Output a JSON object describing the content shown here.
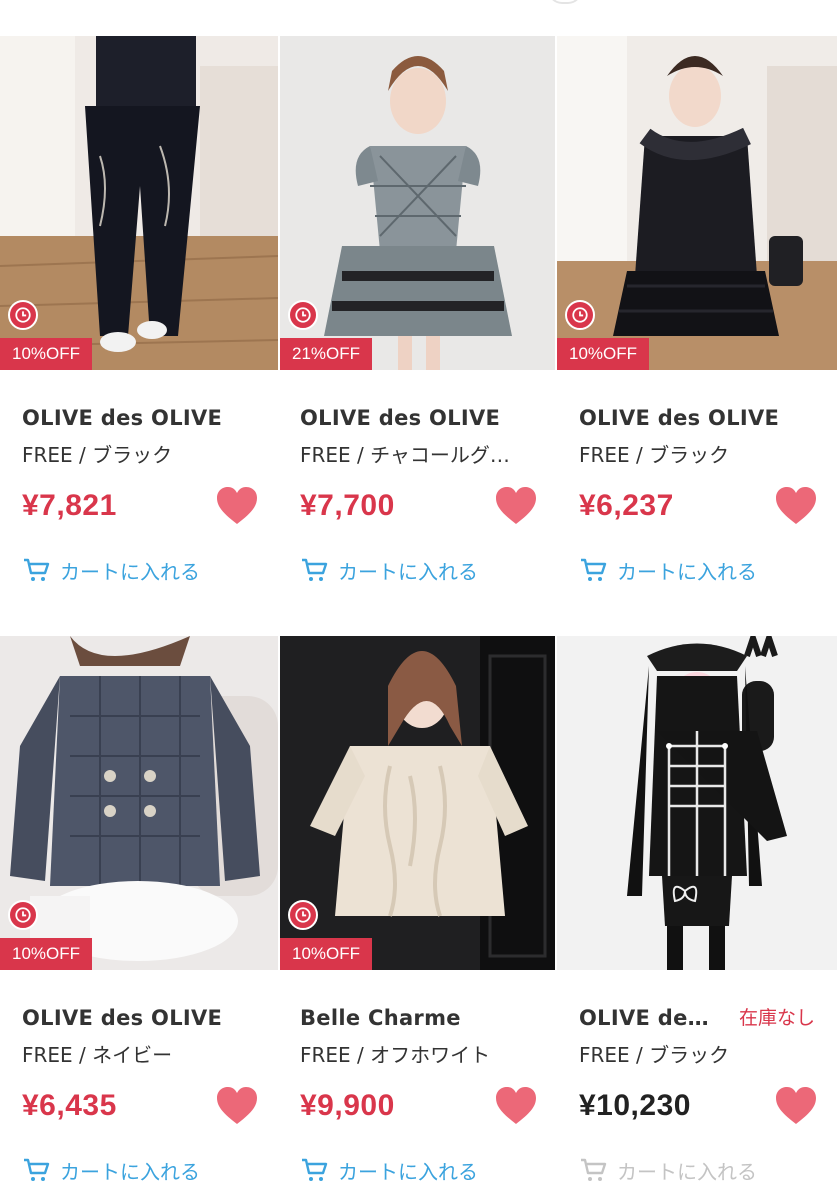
{
  "products": [
    {
      "brand": "OLIVE des OLIVE",
      "variant": "FREE / ブラック",
      "price": "¥7,821",
      "discount": "10%OFF",
      "stock": "",
      "on_sale": true,
      "cart_label": "カートに入れる",
      "image": "black wide-leg pants with embroidered script, lace-up top"
    },
    {
      "brand": "OLIVE des OLIVE",
      "variant": "FREE / チャコールグ…",
      "price": "¥7,700",
      "discount": "21%OFF",
      "stock": "",
      "on_sale": true,
      "cart_label": "カートに入れる",
      "image": "charcoal plaid puff-sleeve set with tiered lace skirt"
    },
    {
      "brand": "OLIVE des OLIVE",
      "variant": "FREE / ブラック",
      "price": "¥6,237",
      "discount": "10%OFF",
      "stock": "",
      "on_sale": true,
      "cart_label": "カートに入れる",
      "image": "black fur-collar cardigan with frill skirt"
    },
    {
      "brand": "OLIVE des OLIVE",
      "variant": "FREE / ネイビー",
      "price": "¥6,435",
      "discount": "10%OFF",
      "stock": "",
      "on_sale": true,
      "cart_label": "カートに入れる",
      "image": "navy gingham double-breasted jacket with white bloomers"
    },
    {
      "brand": "Belle Charme",
      "variant": "FREE / オフホワイト",
      "price": "¥9,900",
      "discount": "10%OFF",
      "stock": "",
      "on_sale": true,
      "cart_label": "カートに入れる",
      "image": "off-white cable knit oversized sweater"
    },
    {
      "brand": "OLIVE de…",
      "variant": "FREE / ブラック",
      "price": "¥10,230",
      "discount": "",
      "stock": "在庫なし",
      "on_sale": false,
      "cart_label": "カートに入れる",
      "image": "black military-style dress with white braid trim"
    }
  ],
  "colors": {
    "accent_red": "#d9364b",
    "heart_pink": "#ec6878",
    "cart_blue": "#3ba3de",
    "disabled_gray": "#c4c4c4"
  },
  "icons": {
    "timer": "clock-icon",
    "favorite": "heart-icon",
    "cart": "cart-icon"
  }
}
